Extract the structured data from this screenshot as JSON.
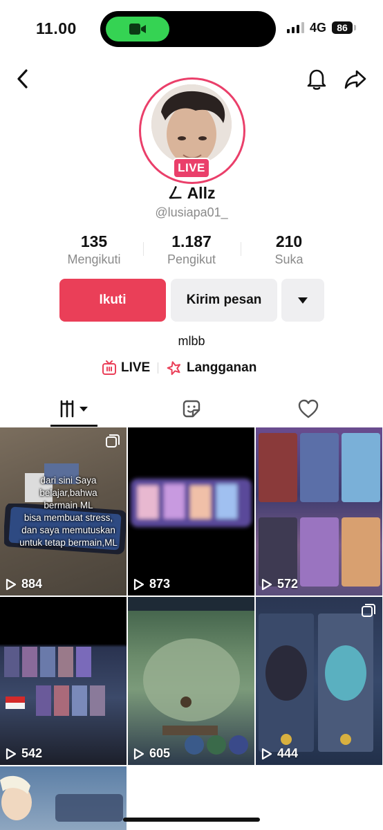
{
  "status_bar": {
    "time": "11.00",
    "network": "4G",
    "battery": "86"
  },
  "profile": {
    "display_name": "Allz",
    "brand_glyph": "ㄥ",
    "username": "@lusiapa01_",
    "live_badge": "LIVE",
    "bio": "mlbb"
  },
  "stats": [
    {
      "value": "135",
      "label": "Mengikuti"
    },
    {
      "value": "1.187",
      "label": "Pengikut"
    },
    {
      "value": "210",
      "label": "Suka"
    }
  ],
  "actions": {
    "follow_label": "Ikuti",
    "message_label": "Kirim pesan"
  },
  "links": {
    "live_label": "LIVE",
    "subscription_label": "Langganan"
  },
  "grid": {
    "videos": [
      {
        "views": "884",
        "overlay_lines": [
          "dari sini Saya",
          "belajar,bahwa",
          "bermain ML",
          "bisa membuat stress,",
          "dan saya memutuskan",
          "untuk tetap bermain,ML"
        ]
      },
      {
        "views": "873"
      },
      {
        "views": "572"
      },
      {
        "views": "542"
      },
      {
        "views": "605"
      },
      {
        "views": "444"
      }
    ]
  },
  "colors": {
    "accent": "#ea3f58",
    "live": "#ea3f6a",
    "muted": "#8a8a8a"
  }
}
